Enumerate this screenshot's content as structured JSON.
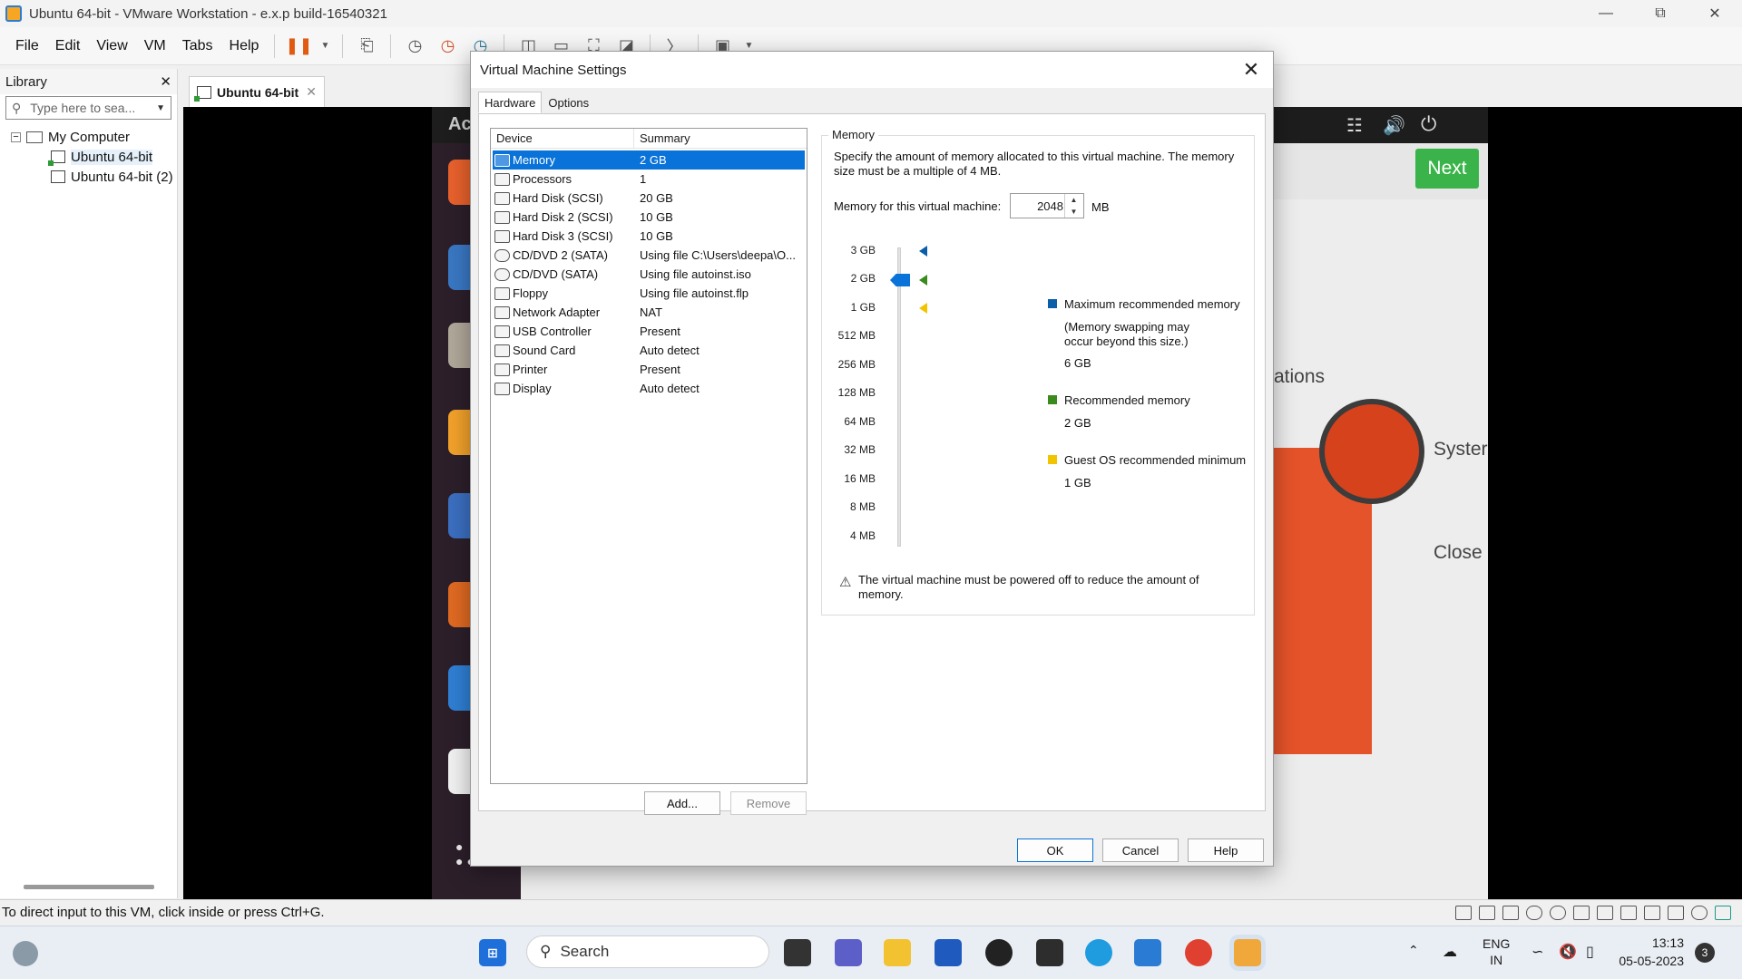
{
  "window": {
    "title": "Ubuntu 64-bit - VMware Workstation - e.x.p build-16540321"
  },
  "menu": [
    "File",
    "Edit",
    "View",
    "VM",
    "Tabs",
    "Help"
  ],
  "library": {
    "title": "Library",
    "search_placeholder": "Type here to sea...",
    "tree": {
      "root": "My Computer",
      "items": [
        "Ubuntu 64-bit",
        "Ubuntu 64-bit (2)"
      ]
    }
  },
  "vm_tab": {
    "label": "Ubuntu 64-bit"
  },
  "guest": {
    "next_label": "Next",
    "partial_texts": [
      "Ac",
      "ations",
      "Syster",
      "Close"
    ]
  },
  "status_bar": {
    "text": "To direct input to this VM, click inside or press Ctrl+G."
  },
  "dialog": {
    "title": "Virtual Machine Settings",
    "tabs": [
      "Hardware",
      "Options"
    ],
    "active_tab": "Hardware",
    "device_list": {
      "headers": [
        "Device",
        "Summary"
      ],
      "rows": [
        {
          "device": "Memory",
          "summary": "2 GB",
          "icon": "memory-icon",
          "selected": true
        },
        {
          "device": "Processors",
          "summary": "1",
          "icon": "processor-icon"
        },
        {
          "device": "Hard Disk (SCSI)",
          "summary": "20 GB",
          "icon": "hard-disk-icon"
        },
        {
          "device": "Hard Disk 2 (SCSI)",
          "summary": "10 GB",
          "icon": "hard-disk-icon"
        },
        {
          "device": "Hard Disk 3 (SCSI)",
          "summary": "10 GB",
          "icon": "hard-disk-icon"
        },
        {
          "device": "CD/DVD 2 (SATA)",
          "summary": "Using file C:\\Users\\deepa\\O...",
          "icon": "cd-dvd-icon"
        },
        {
          "device": "CD/DVD (SATA)",
          "summary": "Using file autoinst.iso",
          "icon": "cd-dvd-icon"
        },
        {
          "device": "Floppy",
          "summary": "Using file autoinst.flp",
          "icon": "floppy-icon"
        },
        {
          "device": "Network Adapter",
          "summary": "NAT",
          "icon": "network-icon"
        },
        {
          "device": "USB Controller",
          "summary": "Present",
          "icon": "usb-icon"
        },
        {
          "device": "Sound Card",
          "summary": "Auto detect",
          "icon": "speaker-icon"
        },
        {
          "device": "Printer",
          "summary": "Present",
          "icon": "printer-icon"
        },
        {
          "device": "Display",
          "summary": "Auto detect",
          "icon": "display-icon"
        }
      ]
    },
    "add_label": "Add...",
    "remove_label": "Remove",
    "memory": {
      "group_title": "Memory",
      "description": "Specify the amount of memory allocated to this virtual machine. The memory size must be a multiple of 4 MB.",
      "field_label": "Memory for this virtual machine:",
      "value": "2048",
      "unit": "MB",
      "scale": [
        "3 GB",
        "2 GB",
        "1 GB",
        "512 MB",
        "256 MB",
        "128 MB",
        "64 MB",
        "32 MB",
        "16 MB",
        "8 MB",
        "4 MB"
      ],
      "legend": {
        "max_title": "Maximum recommended memory",
        "max_note": "(Memory swapping may occur beyond this size.)",
        "max_value": "6 GB",
        "rec_title": "Recommended memory",
        "rec_value": "2 GB",
        "min_title": "Guest OS recommended minimum",
        "min_value": "1 GB"
      },
      "colors": {
        "max": "#0a5ea8",
        "recommended": "#3a8a1e",
        "minimum": "#f2c400",
        "thumb": "#0a73d9"
      },
      "warning": "The virtual machine must be powered off to reduce the amount of memory."
    },
    "ok_label": "OK",
    "cancel_label": "Cancel",
    "help_label": "Help"
  },
  "taskbar": {
    "search_label": "Search",
    "lang": "ENG",
    "region": "IN",
    "time": "13:13",
    "date": "05-05-2023",
    "notification_count": "3"
  }
}
